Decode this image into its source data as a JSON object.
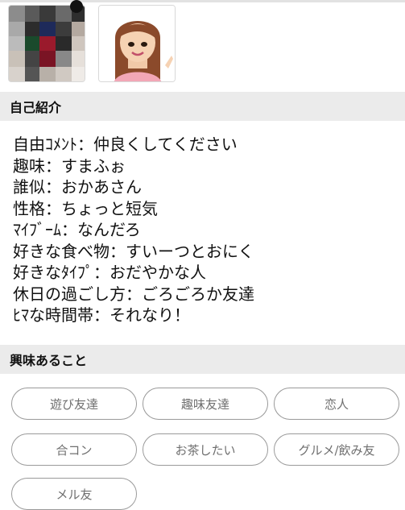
{
  "profile_photos": [
    {
      "name": "photo-1",
      "type": "pixelated-photo"
    },
    {
      "name": "photo-2",
      "type": "cartoon-avatar"
    }
  ],
  "self_intro": {
    "heading": "自己紹介",
    "lines": [
      "自由ｺﾒﾝﾄ：仲良くしてください",
      "趣味：すまふぉ",
      "誰似：おかあさん",
      "性格：ちょっと短気",
      "ﾏｲﾌﾞｰﾑ：なんだろ",
      "好きな食べ物：すいーつとおにく",
      "好きなﾀｲﾌﾟ：おだやかな人",
      "休日の過ごし方：ごろごろか友達",
      "ﾋﾏな時間帯：それなり！"
    ]
  },
  "interests": {
    "heading": "興味あること",
    "tags": [
      "遊び友達",
      "趣味友達",
      "恋人",
      "合コン",
      "お茶したい",
      "グルメ/飲み友",
      "メル友"
    ]
  },
  "colors": {
    "header_bg": "#ebebeb",
    "tag_border": "#9a9a9a",
    "tag_text": "#6f6f6f"
  }
}
